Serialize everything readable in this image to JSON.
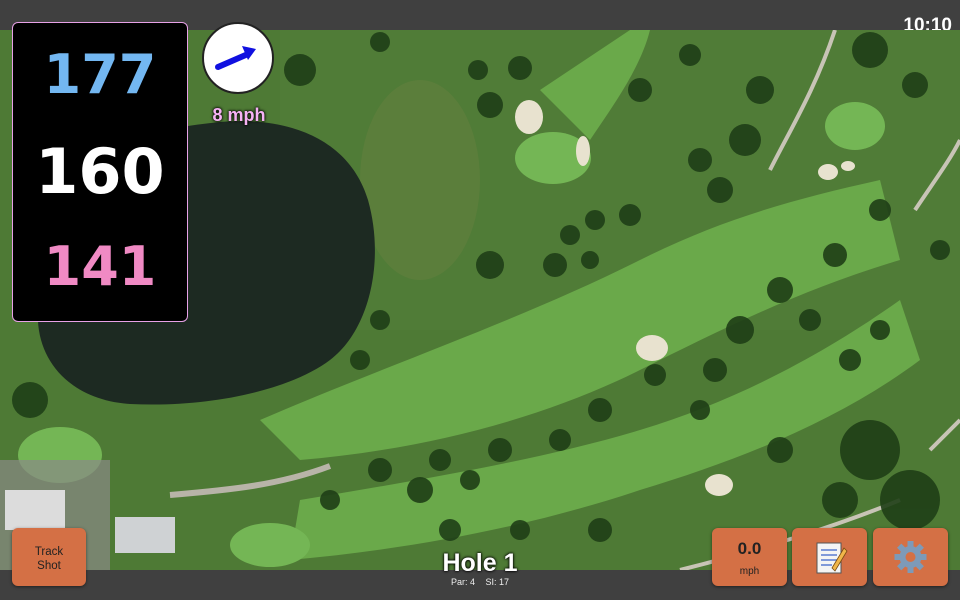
{
  "status": {
    "time": "10:10"
  },
  "yardages": {
    "back": "177",
    "center": "160",
    "front": "141"
  },
  "wind": {
    "speed_label": "8 mph",
    "direction_icon": "arrow-up-right-icon"
  },
  "buttons": {
    "track_shot": "Track\nShot",
    "speed_value": "0.0",
    "speed_unit": "mph",
    "notes_icon": "notepad-icon",
    "settings_icon": "gear-icon"
  },
  "hole": {
    "title": "Hole 1",
    "par": "Par: 4",
    "si": "SI: 17"
  },
  "colors": {
    "back": "#73b7f1",
    "center": "#ffffff",
    "front": "#f08ac4",
    "button": "#d47045",
    "wind_text": "#f6b2f4",
    "bar": "#404040"
  }
}
